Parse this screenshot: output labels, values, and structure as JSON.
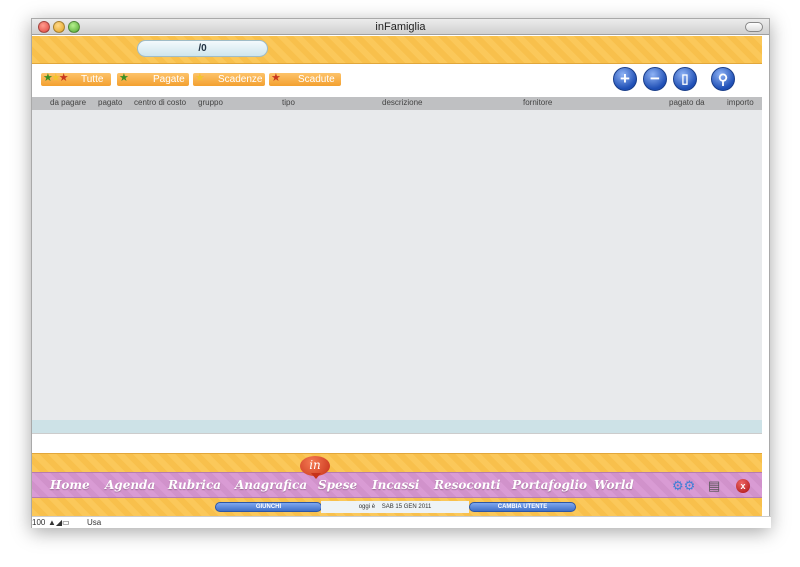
{
  "window": {
    "title": "inFamiglia"
  },
  "counter": {
    "value": "/0"
  },
  "filters": [
    {
      "label": "Tutte"
    },
    {
      "label": "Pagate"
    },
    {
      "label": "Scadenze"
    },
    {
      "label": "Scadute"
    }
  ],
  "actions": {
    "add": "+",
    "remove": "−",
    "duplicate": "▯",
    "search": "⚲"
  },
  "columns": [
    "da pagare",
    "pagato",
    "centro di costo",
    "gruppo",
    "tipo",
    "descrizione",
    "fornitore",
    "pagato da",
    "importo"
  ],
  "nav": {
    "logo": "in",
    "items": [
      "Home",
      "Agenda",
      "Rubrica",
      "Anagrafica",
      "Spese",
      "Incassi",
      "Resoconti",
      "Portafoglio",
      "World"
    ]
  },
  "status": {
    "user": "GIUNCHI",
    "today_label": "oggi è",
    "date": "SAB 15 GEN 2011",
    "change_user": "CAMBIA UTENTE"
  },
  "bottom": {
    "zoom": "100",
    "mode": "Usa"
  }
}
